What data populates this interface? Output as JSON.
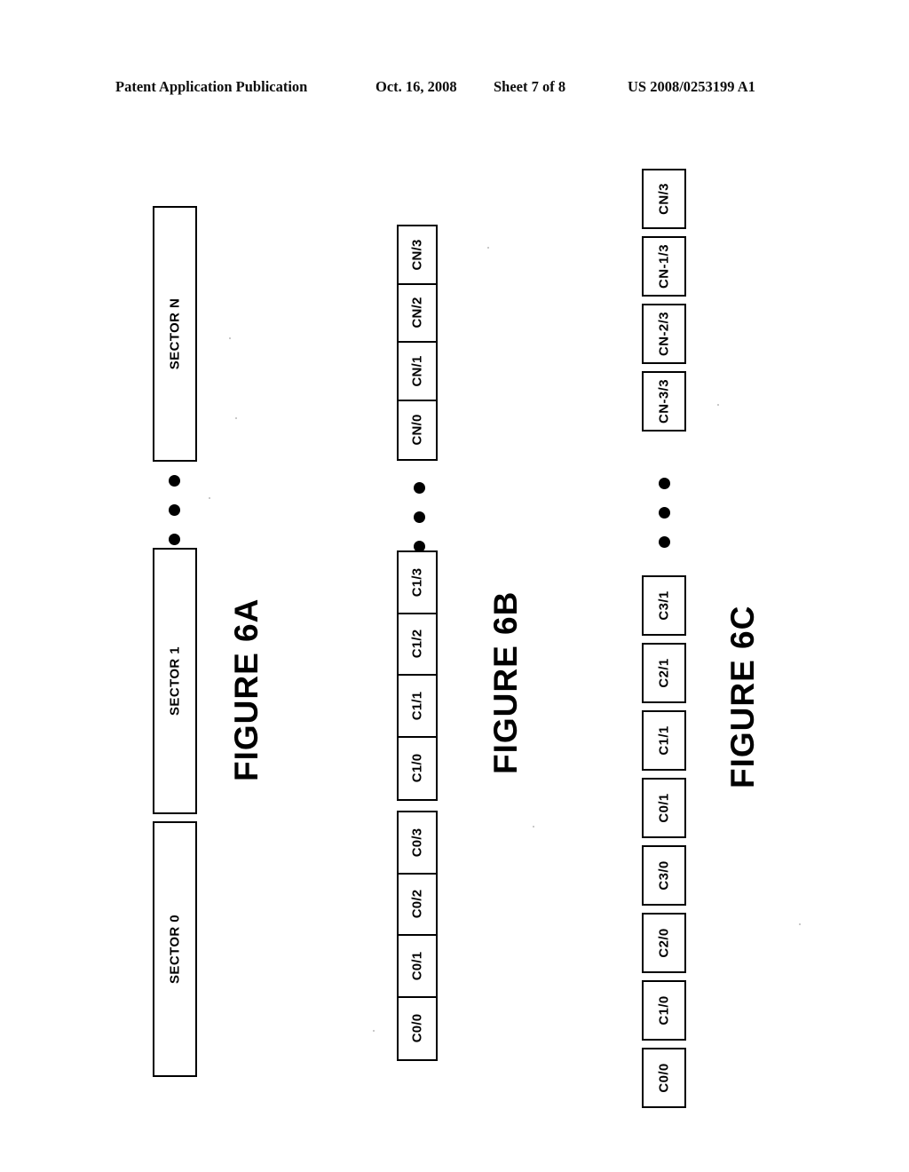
{
  "header": {
    "publication": "Patent Application Publication",
    "date": "Oct. 16, 2008",
    "sheet": "Sheet 7 of 8",
    "patent_number": "US 2008/0253199 A1"
  },
  "figures": [
    {
      "id": "fig-6a",
      "caption": "FIGURE 6A",
      "style": "sector-bars",
      "items": [
        {
          "label": "SECTOR N"
        },
        {
          "label": "SECTOR 1"
        },
        {
          "label": "SECTOR 0"
        }
      ],
      "ellipsis_after_index": 0,
      "ellipsis_dots": 3
    },
    {
      "id": "fig-6b",
      "caption": "FIGURE 6B",
      "style": "contiguous-cell-groups",
      "groups": [
        {
          "name": "CN",
          "cells": [
            "CN/3",
            "CN/2",
            "CN/1",
            "CN/0"
          ]
        },
        {
          "name": "C1",
          "cells": [
            "C1/3",
            "C1/2",
            "C1/1",
            "C1/0"
          ]
        },
        {
          "name": "C0",
          "cells": [
            "C0/3",
            "C0/2",
            "C0/1",
            "C0/0"
          ]
        }
      ],
      "ellipsis_after_group_index": 0,
      "ellipsis_dots": 3
    },
    {
      "id": "fig-6c",
      "caption": "FIGURE 6C",
      "style": "separate-boxes",
      "items": [
        {
          "label": "CN/3"
        },
        {
          "label": "CN-1/3"
        },
        {
          "label": "CN-2/3"
        },
        {
          "label": "CN-3/3"
        },
        {
          "label": "C3/1"
        },
        {
          "label": "C2/1"
        },
        {
          "label": "C1/1"
        },
        {
          "label": "C0/1"
        },
        {
          "label": "C3/0"
        },
        {
          "label": "C2/0"
        },
        {
          "label": "C1/0"
        },
        {
          "label": "C0/0"
        }
      ],
      "ellipsis_after_index": 3,
      "ellipsis_dots": 3
    }
  ],
  "colors": {
    "ink": "#000000",
    "paper": "#ffffff"
  }
}
